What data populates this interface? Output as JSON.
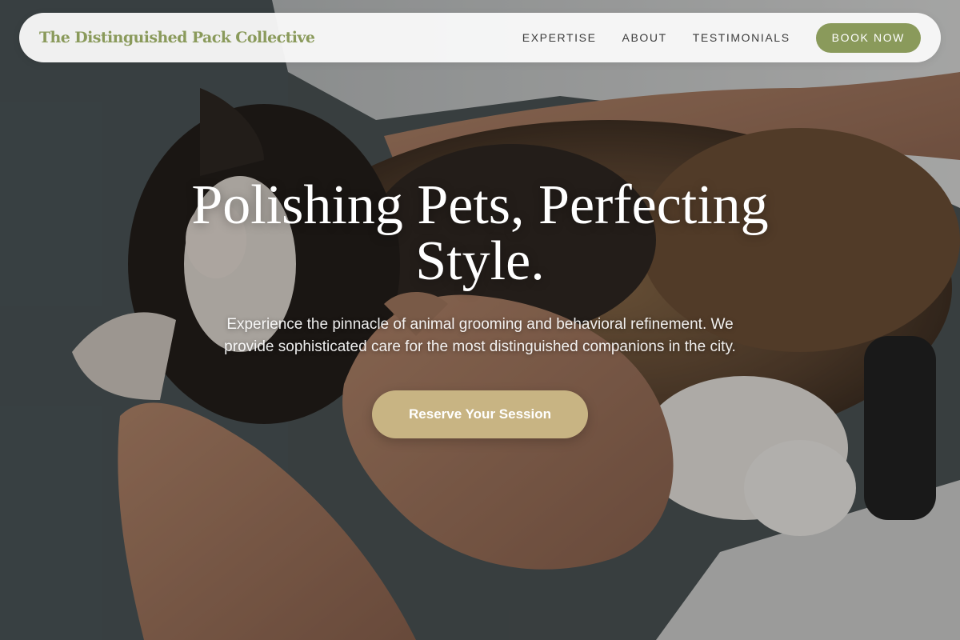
{
  "nav": {
    "brand": "The Distinguished Pack Collective",
    "links": [
      "EXPERTISE",
      "ABOUT",
      "TESTIMONIALS"
    ],
    "book_label": "BOOK NOW"
  },
  "hero": {
    "headline": "Polishing Pets, Perfecting Style.",
    "subtext": "Experience the pinnacle of animal grooming and behavioral refinement. We provide sophisticated care for the most distinguished companions in the city.",
    "cta_label": "Reserve Your Session",
    "image_icon": "cat-in-arms-photo"
  },
  "colors": {
    "brand": "#8a9a5b",
    "accent": "#c8b483",
    "nav_bg": "#fafafa"
  }
}
